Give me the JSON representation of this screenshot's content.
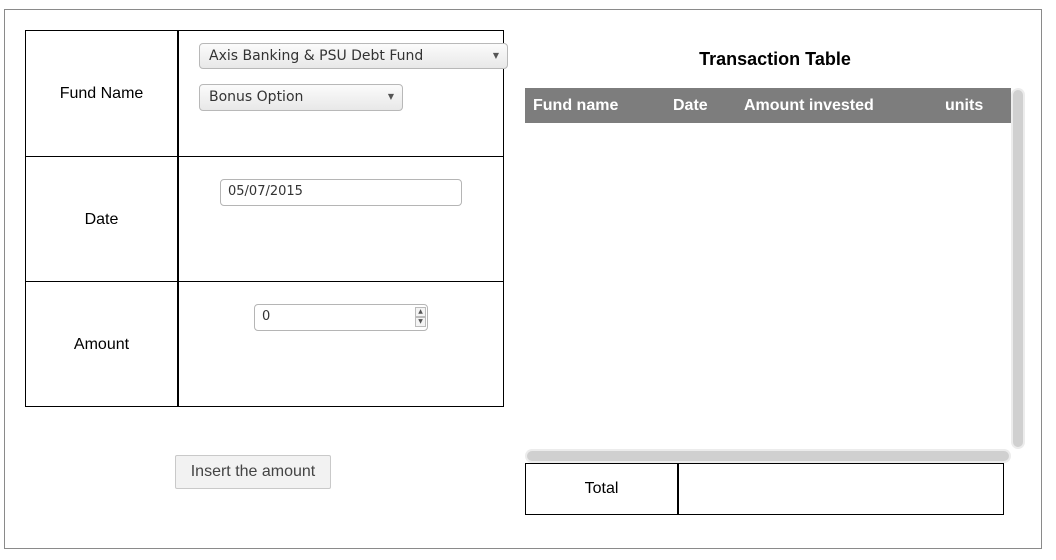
{
  "form": {
    "fund_name_label": "Fund Name",
    "fund_select_value": "Axis Banking & PSU Debt Fund",
    "option_select_value": "Bonus Option",
    "date_label": "Date",
    "date_value": "05/07/2015",
    "amount_label": "Amount",
    "amount_value": "0",
    "insert_button_label": "Insert the amount"
  },
  "transaction_table": {
    "title": "Transaction Table",
    "columns": [
      "Fund name",
      "Date",
      "Amount invested",
      "units"
    ],
    "rows": [],
    "total_label": "Total",
    "total_value": ""
  },
  "icons": {
    "dropdown": "chevron-down-icon",
    "spinner_up": "spinner-up-icon",
    "spinner_down": "spinner-down-icon"
  },
  "colors": {
    "table_header_bg": "#7d7d7d",
    "table_header_text": "#ffffff"
  }
}
